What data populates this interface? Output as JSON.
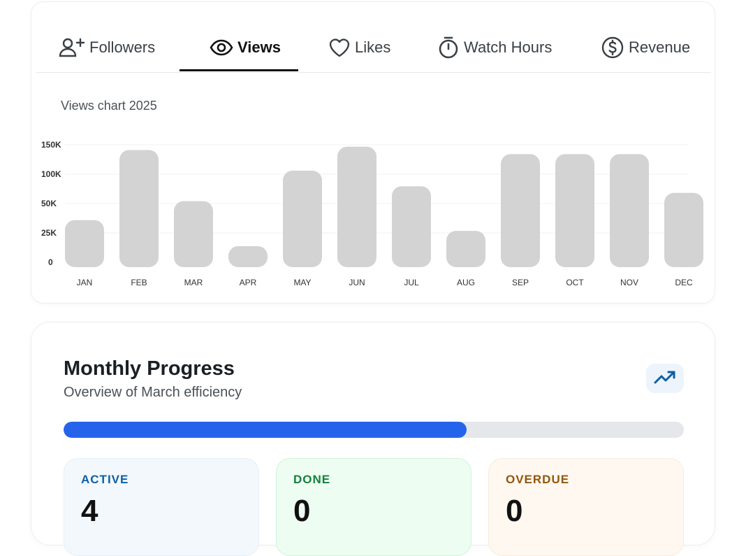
{
  "tabs": [
    {
      "label": "Followers",
      "icon": "user-plus-icon"
    },
    {
      "label": "Views",
      "icon": "eye-icon",
      "active": true
    },
    {
      "label": "Likes",
      "icon": "heart-icon"
    },
    {
      "label": "Watch Hours",
      "icon": "stopwatch-icon"
    },
    {
      "label": "Revenue",
      "icon": "dollar-circle-icon"
    }
  ],
  "chart_title": "Views chart 2025",
  "chart_data": {
    "type": "bar",
    "title": "Views chart 2025",
    "categories": [
      "JAN",
      "FEB",
      "MAR",
      "APR",
      "MAY",
      "JUN",
      "JUL",
      "AUG",
      "SEP",
      "OCT",
      "NOV",
      "DEC"
    ],
    "values": [
      57000,
      142000,
      80000,
      21000,
      117000,
      146000,
      98000,
      44000,
      137000,
      137000,
      137000,
      90000
    ],
    "yticks": [
      {
        "label": "150K",
        "value": 150000
      },
      {
        "label": "100K",
        "value": 100000
      },
      {
        "label": "50K",
        "value": 50000
      },
      {
        "label": "25K",
        "value": 25000
      },
      {
        "label": "0",
        "value": 0
      }
    ],
    "ylim": [
      0,
      150000
    ],
    "grid": true,
    "bar_color": "#d3d3d3"
  },
  "progress": {
    "title": "Monthly Progress",
    "subtitle": "Overview of March efficiency",
    "percent": 65,
    "trend_icon": "trending-up-icon",
    "bar_color": "#2563eb"
  },
  "stats": [
    {
      "label": "ACTIVE",
      "value": "4",
      "color": "#0b5fa5",
      "bg": "#f3f8fd",
      "border": "#e7eef7"
    },
    {
      "label": "DONE",
      "value": "0",
      "color": "#15803d",
      "bg": "#eefdf2",
      "border": "#d2f3dc"
    },
    {
      "label": "OVERDUE",
      "value": "0",
      "color": "#92560a",
      "bg": "#fff8f1",
      "border": "#f8ebdc"
    }
  ]
}
